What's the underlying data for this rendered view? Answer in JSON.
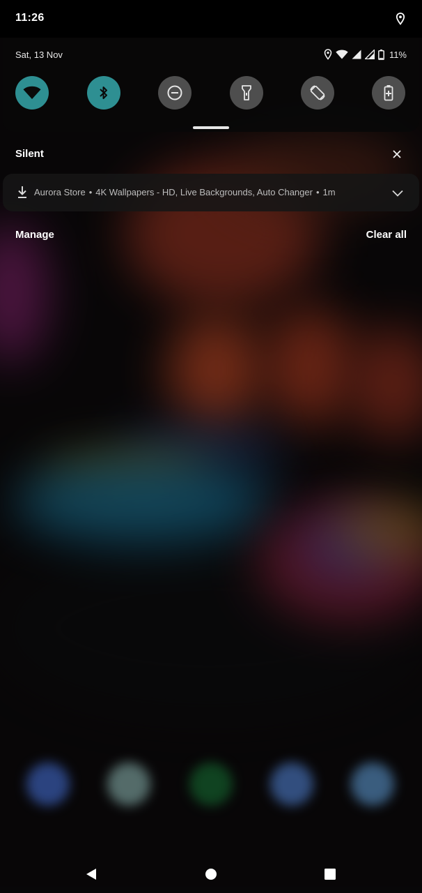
{
  "status_bar": {
    "time": "11:26",
    "icons": [
      "location-icon"
    ]
  },
  "quick_settings": {
    "date": "Sat, 13 Nov",
    "status_icons": [
      "location-icon",
      "wifi-icon",
      "signal-icon",
      "signal-icon",
      "battery-icon"
    ],
    "battery_percent": "11%",
    "accent_color": "#2e8f92",
    "inactive_color": "#4e4e4e",
    "tiles": [
      {
        "name": "wifi",
        "icon": "wifi-icon",
        "active": true
      },
      {
        "name": "bluetooth",
        "icon": "bluetooth-icon",
        "active": true
      },
      {
        "name": "do-not-disturb",
        "icon": "dnd-icon",
        "active": false
      },
      {
        "name": "flashlight",
        "icon": "flashlight-icon",
        "active": false
      },
      {
        "name": "auto-rotate",
        "icon": "rotate-icon",
        "active": false
      },
      {
        "name": "battery-saver",
        "icon": "battery-saver-icon",
        "active": false
      }
    ]
  },
  "notifications": {
    "section_title": "Silent",
    "items": [
      {
        "icon": "download-icon",
        "app": "Aurora Store",
        "title": "4K Wallpapers - HD, Live Backgrounds, Auto Changer",
        "time": "1m"
      }
    ],
    "manage_label": "Manage",
    "clear_all_label": "Clear all"
  },
  "nav_bar": {
    "buttons": [
      "back-icon",
      "home-icon",
      "recents-icon"
    ]
  }
}
